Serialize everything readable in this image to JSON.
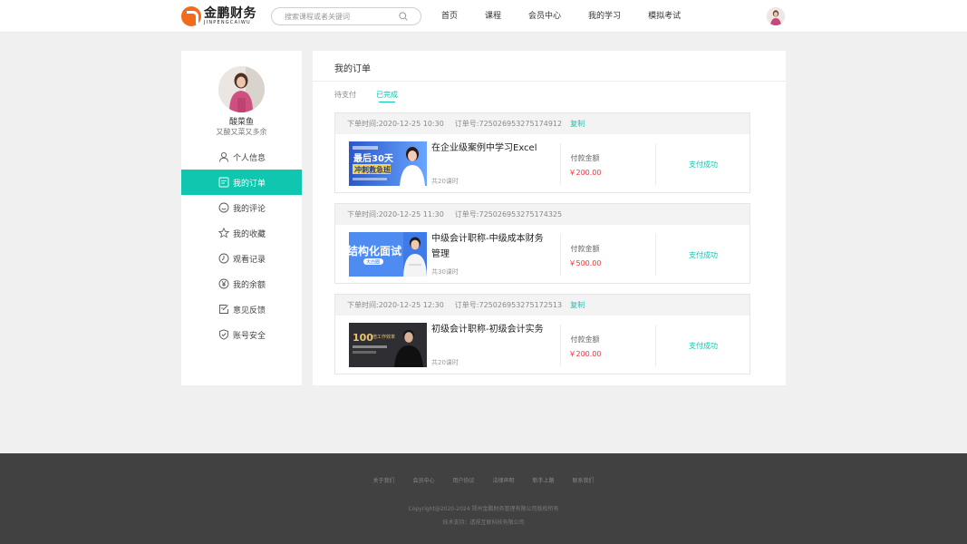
{
  "header": {
    "logo_cn": "金鹏财务",
    "logo_en": "JINPENGCAIWU",
    "search_placeholder": "搜索课程或者关键词",
    "nav": [
      "首页",
      "课程",
      "会员中心",
      "我的学习",
      "模拟考试"
    ]
  },
  "sidebar": {
    "username": "酸菜鱼",
    "signature": "又酸又菜又多余",
    "menu": [
      {
        "label": "个人信息",
        "icon": "user-icon"
      },
      {
        "label": "我的订单",
        "icon": "order-icon",
        "active": true
      },
      {
        "label": "我的评论",
        "icon": "comment-icon"
      },
      {
        "label": "我的收藏",
        "icon": "star-icon"
      },
      {
        "label": "观看记录",
        "icon": "clock-icon"
      },
      {
        "label": "我的余额",
        "icon": "yen-icon"
      },
      {
        "label": "意见反馈",
        "icon": "edit-icon"
      },
      {
        "label": "账号安全",
        "icon": "shield-icon"
      }
    ]
  },
  "main": {
    "title": "我的订单",
    "tabs": [
      {
        "label": "待支付",
        "active": false
      },
      {
        "label": "已完成",
        "active": true
      }
    ],
    "copy_label": "复制",
    "pay_label": "付款金额",
    "orders": [
      {
        "time": "下单时间:2020-12-25  10:30",
        "order_no": "订单号:725026953275174912",
        "show_copy": true,
        "course_title": "在企业级案例中学习Excel",
        "lessons": "共20课时",
        "amount": "￥200.00",
        "status": "支付成功",
        "thumb_text": "最后30天",
        "thumb_sub": "冲刺救急班"
      },
      {
        "time": "下单时间:2020-12-25  11:30",
        "order_no": "订单号:725026953275174325",
        "show_copy": true,
        "course_title": "中级会计职称-中级成本财务管理",
        "lessons": "共30课时",
        "amount": "￥500.00",
        "status": "支付成功",
        "thumb_text": "结构化面试",
        "thumb_sub": "大白圈"
      },
      {
        "time": "下单时间:2020-12-25  12:30",
        "order_no": "订单号:725026953275172513",
        "show_copy": true,
        "course_title": "初级会计职称-初级会计实务",
        "lessons": "共20课时",
        "amount": "￥200.00",
        "status": "支付成功",
        "thumb_text": "100",
        "thumb_sub": "倍工作效率"
      }
    ]
  },
  "footer": {
    "links": [
      "关于我们",
      "会员中心",
      "用户协议",
      "法律声明",
      "新手上路",
      "联系我们"
    ],
    "copyright": "Copyright@2020-2024 郑州金鹏财务管理有限公司版权所有",
    "support": "技术支持：透视互联科技有限公司"
  },
  "colors": {
    "accent": "#10c6ae",
    "price": "#f4333c",
    "logo": "#f26b1d",
    "footer_bg": "#414141"
  }
}
